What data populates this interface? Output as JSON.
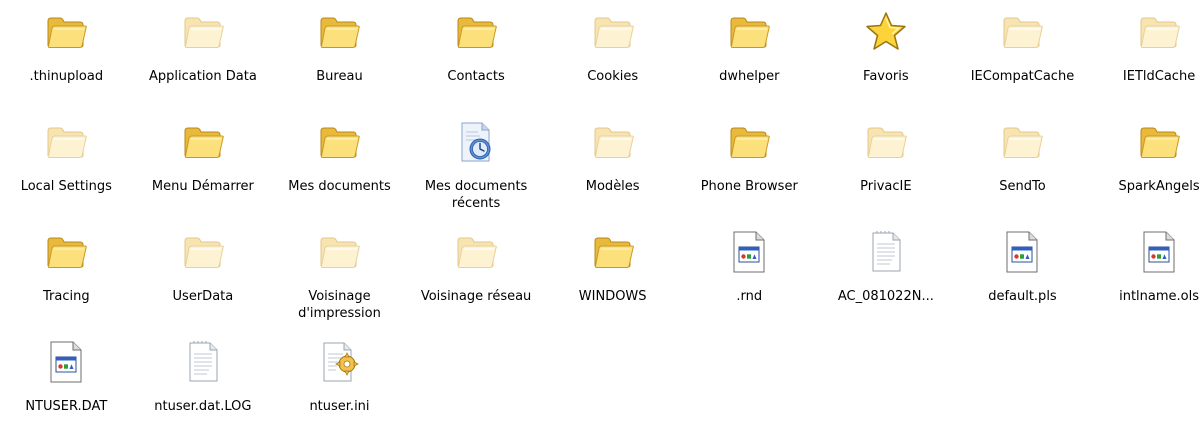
{
  "items": [
    {
      "label": ".thinupload",
      "type": "folder"
    },
    {
      "label": "Application Data",
      "type": "folder-hidden"
    },
    {
      "label": "Bureau",
      "type": "folder"
    },
    {
      "label": "Contacts",
      "type": "folder"
    },
    {
      "label": "Cookies",
      "type": "folder-hidden"
    },
    {
      "label": "dwhelper",
      "type": "folder"
    },
    {
      "label": "Favoris",
      "type": "favorites"
    },
    {
      "label": "IECompatCache",
      "type": "folder-hidden"
    },
    {
      "label": "IETldCache",
      "type": "folder-hidden"
    },
    {
      "label": "Local Settings",
      "type": "folder-hidden"
    },
    {
      "label": "Menu Démarrer",
      "type": "folder"
    },
    {
      "label": "Mes documents",
      "type": "folder"
    },
    {
      "label": "Mes documents récents",
      "type": "recent-docs"
    },
    {
      "label": "Modèles",
      "type": "folder-hidden"
    },
    {
      "label": "Phone Browser",
      "type": "folder"
    },
    {
      "label": "PrivacIE",
      "type": "folder-hidden"
    },
    {
      "label": "SendTo",
      "type": "folder-hidden"
    },
    {
      "label": "SparkAngels",
      "type": "folder"
    },
    {
      "label": "Tracing",
      "type": "folder"
    },
    {
      "label": "UserData",
      "type": "folder-hidden"
    },
    {
      "label": "Voisinage d'impression",
      "type": "folder-hidden"
    },
    {
      "label": "Voisinage réseau",
      "type": "folder-hidden"
    },
    {
      "label": "WINDOWS",
      "type": "folder"
    },
    {
      "label": ".rnd",
      "type": "app-file"
    },
    {
      "label": "AC_081022N...",
      "type": "text-file"
    },
    {
      "label": "default.pls",
      "type": "app-file"
    },
    {
      "label": "intlname.ols",
      "type": "app-file"
    },
    {
      "label": "NTUSER.DAT",
      "type": "app-file"
    },
    {
      "label": "ntuser.dat.LOG",
      "type": "text-file"
    },
    {
      "label": "ntuser.ini",
      "type": "ini-file"
    }
  ]
}
